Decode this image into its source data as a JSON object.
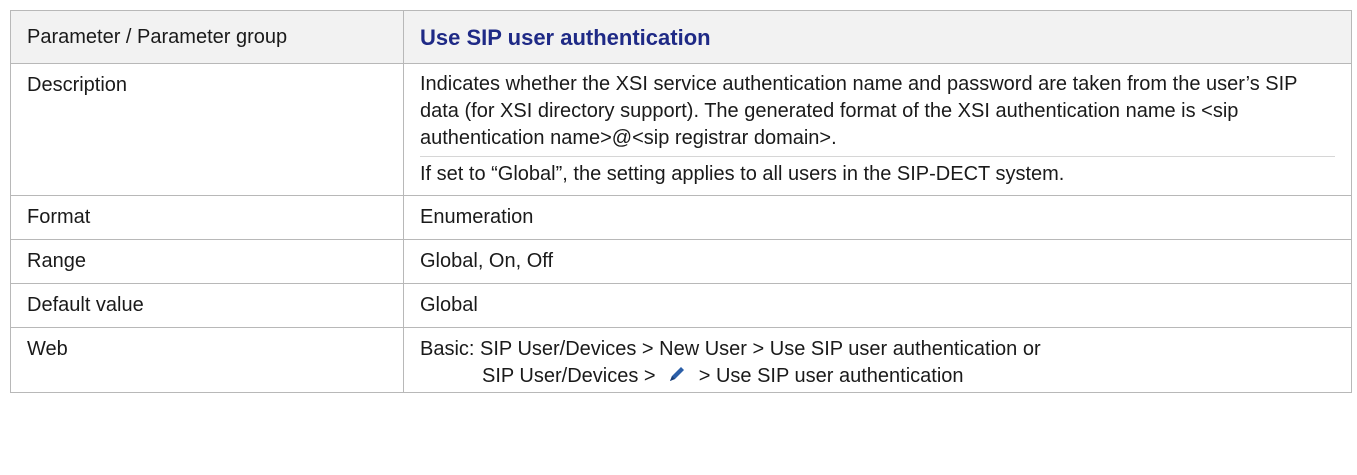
{
  "header": {
    "label": "Parameter / Parameter group",
    "title": "Use SIP user authentication"
  },
  "rows": {
    "description": {
      "label": "Description",
      "para1": "Indicates whether the XSI service authentication name and password are taken from the user’s SIP data (for XSI directory support). The generated format of the XSI authentication name is <sip authentication name>@<sip registrar domain>.",
      "para2": "If set to “Global”, the setting applies to all users in the SIP-DECT system."
    },
    "format": {
      "label": "Format",
      "value": "Enumeration"
    },
    "range": {
      "label": "Range",
      "value": "Global, On, Off"
    },
    "default": {
      "label": "Default value",
      "value": "Global"
    },
    "web": {
      "label": "Web",
      "line1": "Basic: SIP User/Devices > New User > Use SIP user authentication or",
      "line2_prefix": "SIP User/Devices >",
      "line2_suffix": ">   Use SIP user authentication",
      "edit_icon": "pencil-icon"
    }
  },
  "colors": {
    "title": "#1f2a86",
    "border": "#b8b8b8",
    "header_bg": "#f2f2f2"
  }
}
